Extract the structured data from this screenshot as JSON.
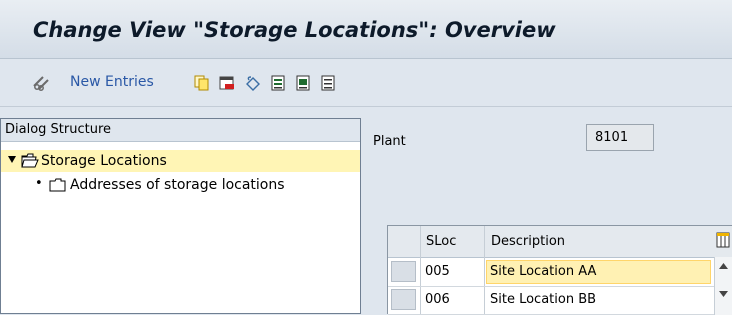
{
  "window": {
    "title": "Change View \"Storage Locations\": Overview"
  },
  "toolbar": {
    "new_entries_label": "New Entries",
    "icons": [
      "edit-glasses-icon",
      "copy-icon",
      "delete-icon",
      "undo-icon",
      "select-all-icon",
      "select-block-icon",
      "deselect-all-icon"
    ]
  },
  "dialog_structure": {
    "header": "Dialog Structure",
    "items": [
      {
        "label": "Storage Locations",
        "expanded": true,
        "selected": true
      },
      {
        "label": "Addresses of storage locations",
        "expanded": false,
        "selected": false
      }
    ]
  },
  "plant": {
    "label": "Plant",
    "value": "8101"
  },
  "table": {
    "columns": [
      "SLoc",
      "Description"
    ],
    "rows": [
      {
        "sloc": "005",
        "description": "Site Location AA"
      },
      {
        "sloc": "006",
        "description": "Site Location BB"
      }
    ]
  },
  "colors": {
    "title_text": "#0d1a2a",
    "link_blue": "#2a58a6",
    "selected_row": "#fff5b5",
    "background": "#dfe6ee"
  }
}
